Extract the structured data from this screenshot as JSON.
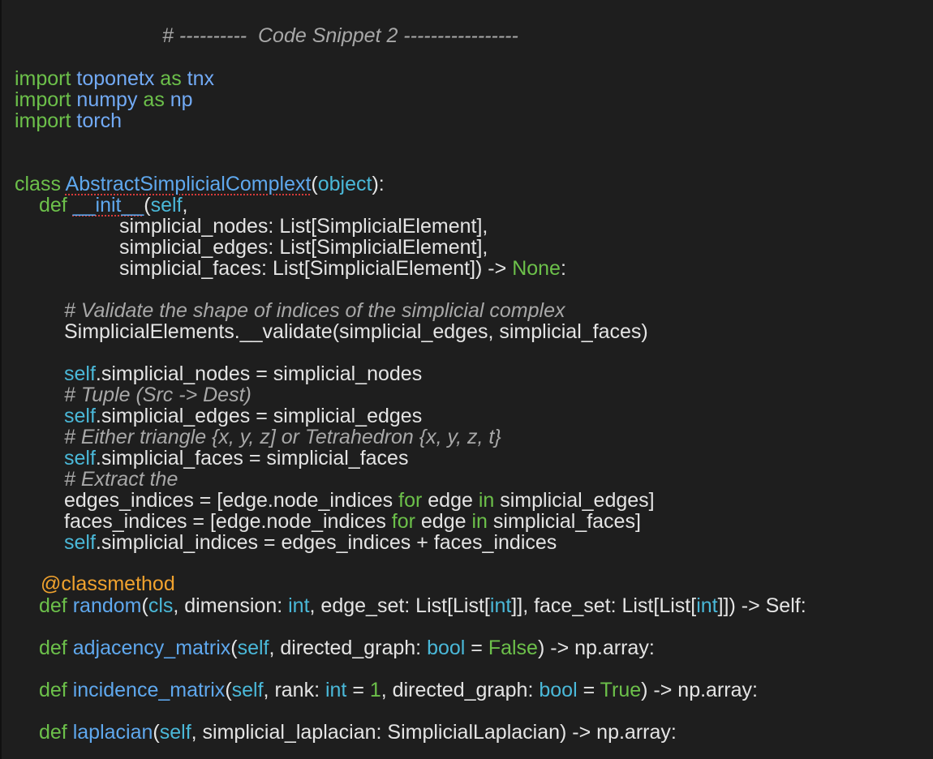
{
  "editor": {
    "background": "#1e1e1e",
    "colors": {
      "keyword": "#6cc04a",
      "module": "#72aaf5",
      "function": "#5fa8ee",
      "self": "#4ab8d8",
      "comment": "#a8a8a8",
      "decorator": "#f0a22e",
      "text": "#e4e4e4",
      "squiggle": "#d63a3a"
    },
    "lines": [
      {
        "key": "header",
        "tokens": [
          {
            "t": "# ----------  Code Snippet 2 -----------------",
            "c": "cm"
          }
        ]
      },
      {
        "key": "import1",
        "tokens": [
          {
            "t": "import",
            "c": "kw"
          },
          {
            "t": " ",
            "c": "txt"
          },
          {
            "t": "toponetx",
            "c": "mod"
          },
          {
            "t": " ",
            "c": "txt"
          },
          {
            "t": "as",
            "c": "kw"
          },
          {
            "t": " ",
            "c": "txt"
          },
          {
            "t": "tnx",
            "c": "mod"
          }
        ]
      },
      {
        "key": "import2",
        "tokens": [
          {
            "t": "import",
            "c": "kw"
          },
          {
            "t": " ",
            "c": "txt"
          },
          {
            "t": "numpy",
            "c": "mod"
          },
          {
            "t": " ",
            "c": "txt"
          },
          {
            "t": "as",
            "c": "kw"
          },
          {
            "t": " ",
            "c": "txt"
          },
          {
            "t": "np",
            "c": "mod"
          }
        ]
      },
      {
        "key": "import3",
        "tokens": [
          {
            "t": "import",
            "c": "kw"
          },
          {
            "t": " ",
            "c": "txt"
          },
          {
            "t": "torch",
            "c": "mod"
          }
        ]
      },
      {
        "key": "class_decl",
        "tokens": [
          {
            "t": "class",
            "c": "kw"
          },
          {
            "t": " ",
            "c": "txt"
          },
          {
            "t": "AbstractSimplicialComplext",
            "c": "fn",
            "squiggle": true
          },
          {
            "t": "(",
            "c": "txt"
          },
          {
            "t": "object",
            "c": "slf"
          },
          {
            "t": "):",
            "c": "txt"
          }
        ]
      },
      {
        "key": "init_def",
        "tokens": [
          {
            "t": "def",
            "c": "kw"
          },
          {
            "t": " ",
            "c": "txt"
          },
          {
            "t": "__init__",
            "c": "fn",
            "squiggle": true
          },
          {
            "t": "(",
            "c": "txt"
          },
          {
            "t": "self",
            "c": "slf"
          },
          {
            "t": ",",
            "c": "txt"
          }
        ]
      },
      {
        "key": "param_nodes",
        "tokens": [
          {
            "t": "simplicial_nodes: List[SimplicialElement],",
            "c": "txt"
          }
        ]
      },
      {
        "key": "param_edges",
        "tokens": [
          {
            "t": "simplicial_edges: List[SimplicialElement],",
            "c": "txt"
          }
        ]
      },
      {
        "key": "param_faces",
        "tokens": [
          {
            "t": "simplicial_faces: List[SimplicialElement]) -> ",
            "c": "txt"
          },
          {
            "t": "None",
            "c": "kw"
          },
          {
            "t": ":",
            "c": "txt"
          }
        ]
      },
      {
        "key": "comment_validate",
        "tokens": [
          {
            "t": "# Validate the shape of indices of the simplicial complex",
            "c": "cm"
          }
        ]
      },
      {
        "key": "validate_call",
        "tokens": [
          {
            "t": "SimplicialElements.__validate(simplicial_edges, simplicial_faces)",
            "c": "txt"
          }
        ]
      },
      {
        "key": "assign_nodes",
        "tokens": [
          {
            "t": "self",
            "c": "slf"
          },
          {
            "t": ".simplicial_nodes = simplicial_nodes",
            "c": "txt"
          }
        ]
      },
      {
        "key": "comment_tuple",
        "tokens": [
          {
            "t": "# Tuple (Src -> Dest)",
            "c": "cm"
          }
        ]
      },
      {
        "key": "assign_edges",
        "tokens": [
          {
            "t": "self",
            "c": "slf"
          },
          {
            "t": ".simplicial_edges = simplicial_edges",
            "c": "txt"
          }
        ]
      },
      {
        "key": "comment_either",
        "tokens": [
          {
            "t": "# Either triangle {x, y, z] or Tetrahedron {x, y, z, t}",
            "c": "cm"
          }
        ]
      },
      {
        "key": "assign_faces",
        "tokens": [
          {
            "t": "self",
            "c": "slf"
          },
          {
            "t": ".simplicial_faces = simplicial_faces",
            "c": "txt"
          }
        ]
      },
      {
        "key": "comment_extract",
        "tokens": [
          {
            "t": "# Extract the",
            "c": "cm"
          }
        ]
      },
      {
        "key": "edges_indices",
        "tokens": [
          {
            "t": "edges_indices = [edge.node_indices ",
            "c": "txt"
          },
          {
            "t": "for",
            "c": "kw"
          },
          {
            "t": " edge ",
            "c": "txt"
          },
          {
            "t": "in",
            "c": "kw"
          },
          {
            "t": " simplicial_edges]",
            "c": "txt"
          }
        ]
      },
      {
        "key": "faces_indices",
        "tokens": [
          {
            "t": "faces_indices = [edge.node_indices ",
            "c": "txt"
          },
          {
            "t": "for",
            "c": "kw"
          },
          {
            "t": " edge ",
            "c": "txt"
          },
          {
            "t": "in",
            "c": "kw"
          },
          {
            "t": " simplicial_faces]",
            "c": "txt"
          }
        ]
      },
      {
        "key": "assign_indices",
        "tokens": [
          {
            "t": "self",
            "c": "slf"
          },
          {
            "t": ".simplicial_indices = edges_indices + faces_indices",
            "c": "txt"
          }
        ]
      },
      {
        "key": "decorator",
        "tokens": [
          {
            "t": "@classmethod",
            "c": "dec"
          }
        ]
      },
      {
        "key": "random_def",
        "tokens": [
          {
            "t": "def",
            "c": "kw"
          },
          {
            "t": " ",
            "c": "txt"
          },
          {
            "t": "random",
            "c": "fn"
          },
          {
            "t": "(",
            "c": "txt"
          },
          {
            "t": "cls",
            "c": "slf"
          },
          {
            "t": ", dimension: ",
            "c": "txt"
          },
          {
            "t": "int",
            "c": "slf"
          },
          {
            "t": ", edge_set: List[List[",
            "c": "txt"
          },
          {
            "t": "int",
            "c": "slf"
          },
          {
            "t": "]], face_set: List[List[",
            "c": "txt"
          },
          {
            "t": "int",
            "c": "slf"
          },
          {
            "t": "]]) -> Self:",
            "c": "txt"
          }
        ]
      },
      {
        "key": "adjacency_def",
        "tokens": [
          {
            "t": "def",
            "c": "kw"
          },
          {
            "t": " ",
            "c": "txt"
          },
          {
            "t": "adjacency_matrix",
            "c": "fn"
          },
          {
            "t": "(",
            "c": "txt"
          },
          {
            "t": "self",
            "c": "slf"
          },
          {
            "t": ", directed_graph: ",
            "c": "txt"
          },
          {
            "t": "bool",
            "c": "slf"
          },
          {
            "t": " = ",
            "c": "txt"
          },
          {
            "t": "False",
            "c": "kw"
          },
          {
            "t": ") -> np.array:",
            "c": "txt"
          }
        ]
      },
      {
        "key": "incidence_def",
        "tokens": [
          {
            "t": "def",
            "c": "kw"
          },
          {
            "t": " ",
            "c": "txt"
          },
          {
            "t": "incidence_matrix",
            "c": "fn"
          },
          {
            "t": "(",
            "c": "txt"
          },
          {
            "t": "self",
            "c": "slf"
          },
          {
            "t": ", rank: ",
            "c": "txt"
          },
          {
            "t": "int",
            "c": "slf"
          },
          {
            "t": " = ",
            "c": "txt"
          },
          {
            "t": "1",
            "c": "kw"
          },
          {
            "t": ", directed_graph: ",
            "c": "txt"
          },
          {
            "t": "bool",
            "c": "slf"
          },
          {
            "t": " = ",
            "c": "txt"
          },
          {
            "t": "True",
            "c": "kw"
          },
          {
            "t": ") -> np.array:",
            "c": "txt"
          }
        ]
      },
      {
        "key": "laplacian_def",
        "tokens": [
          {
            "t": "def",
            "c": "kw"
          },
          {
            "t": " ",
            "c": "txt"
          },
          {
            "t": "laplacian",
            "c": "fn"
          },
          {
            "t": "(",
            "c": "txt"
          },
          {
            "t": "self",
            "c": "slf"
          },
          {
            "t": ", simplicial_laplacian: SimplicialLaplacian) -> np.array:",
            "c": "txt"
          }
        ]
      }
    ]
  }
}
